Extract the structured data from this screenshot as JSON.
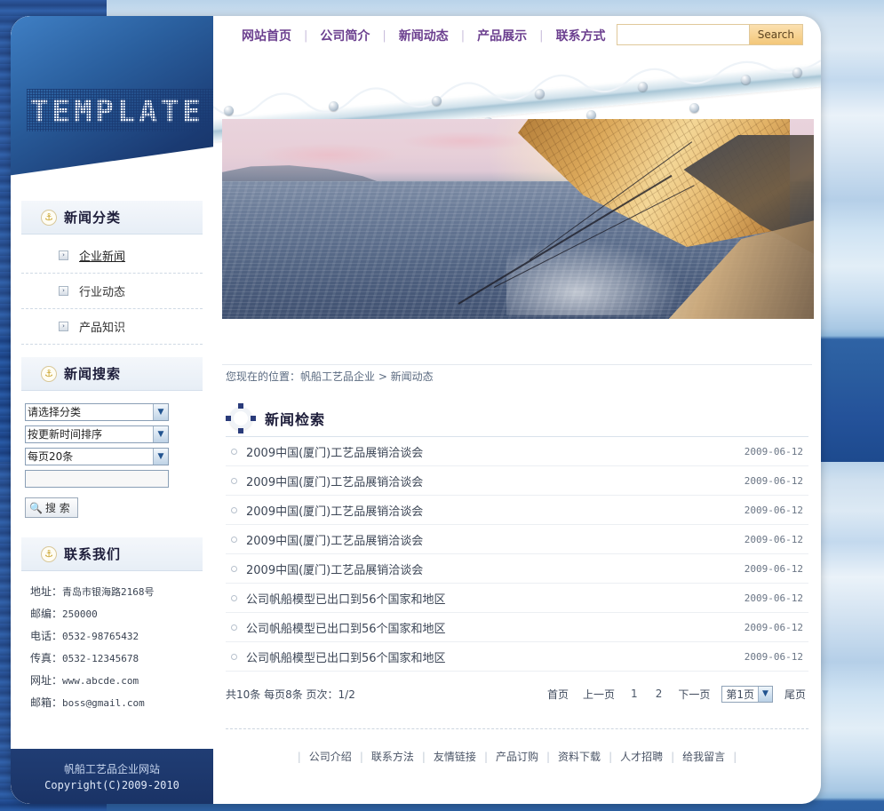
{
  "logo": {
    "text": "TEMPLATE"
  },
  "topnav": {
    "items": [
      {
        "label": "网站首页"
      },
      {
        "label": "公司简介"
      },
      {
        "label": "新闻动态"
      },
      {
        "label": "产品展示"
      },
      {
        "label": "联系方式"
      }
    ],
    "separator": "|"
  },
  "header_search": {
    "value": "",
    "placeholder": "",
    "button_label": "Search"
  },
  "breadcrumb": {
    "text": "您现在的位置：帆船工艺品企业  >  新闻动态"
  },
  "sidebar": {
    "categories": {
      "icon": "anchor-icon",
      "title": "新闻分类",
      "items": [
        {
          "label": "企业新闻",
          "arrow": "›",
          "active": true
        },
        {
          "label": "行业动态",
          "arrow": "›",
          "active": false
        },
        {
          "label": "产品知识",
          "arrow": "›",
          "active": false
        }
      ]
    },
    "search": {
      "icon": "anchor-icon",
      "title": "新闻搜索",
      "category_select": "请选择分类",
      "sort_select": "按更新时间排序",
      "perpage_select": "每页20条",
      "keyword_value": "",
      "keyword_placeholder": "",
      "button_label": "搜 索",
      "button_icon": "magnifier-icon",
      "arrow": "▼"
    },
    "contact": {
      "icon": "anchor-icon",
      "title": "联系我们",
      "lines": [
        {
          "label": "地址：",
          "value": "青岛市银海路2168号"
        },
        {
          "label": "邮编：",
          "value": "250000"
        },
        {
          "label": "电话：",
          "value": "0532-98765432"
        },
        {
          "label": "传真：",
          "value": "0532-12345678"
        },
        {
          "label": "网址：",
          "value": "www.abcde.com"
        },
        {
          "label": "邮箱：",
          "value": "boss@gmail.com"
        }
      ]
    }
  },
  "copyright": {
    "line1": "帆船工艺品企业网站",
    "line2": "Copyright(C)2009-2010"
  },
  "main": {
    "section": {
      "icon": "lifebuoy-icon",
      "title": "新闻检索"
    },
    "news": [
      {
        "title": "2009中国(厦门)工艺品展销洽谈会",
        "date": "2009-06-12"
      },
      {
        "title": "2009中国(厦门)工艺品展销洽谈会",
        "date": "2009-06-12"
      },
      {
        "title": "2009中国(厦门)工艺品展销洽谈会",
        "date": "2009-06-12"
      },
      {
        "title": "2009中国(厦门)工艺品展销洽谈会",
        "date": "2009-06-12"
      },
      {
        "title": "2009中国(厦门)工艺品展销洽谈会",
        "date": "2009-06-12"
      },
      {
        "title": "公司帆船模型已出口到56个国家和地区",
        "date": "2009-06-12"
      },
      {
        "title": "公司帆船模型已出口到56个国家和地区",
        "date": "2009-06-12"
      },
      {
        "title": "公司帆船模型已出口到56个国家和地区",
        "date": "2009-06-12"
      }
    ],
    "pager": {
      "summary": "共10条 每页8条 页次：1/2",
      "first": "首页",
      "prev": "上一页",
      "pages": [
        "1",
        "2"
      ],
      "next": "下一页",
      "jump_value": "第1页",
      "jump_arrow": "▼",
      "last": "尾页"
    }
  },
  "footer": {
    "separator": "|",
    "links": [
      {
        "label": "公司介绍"
      },
      {
        "label": "联系方法"
      },
      {
        "label": "友情链接"
      },
      {
        "label": "产品订购"
      },
      {
        "label": "资料下载"
      },
      {
        "label": "人才招聘"
      },
      {
        "label": "给我留言"
      }
    ]
  }
}
